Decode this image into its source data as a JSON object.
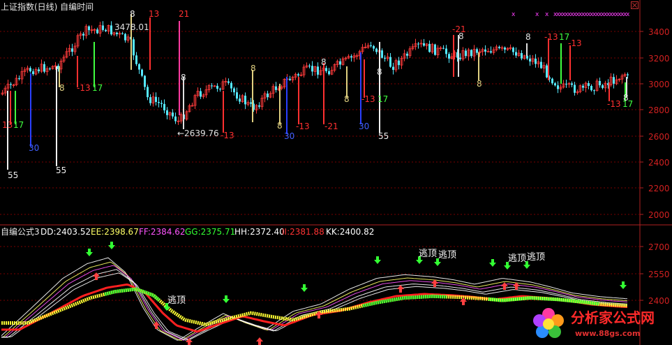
{
  "top_panel": {
    "title": "上证指数(日线) 自编时间",
    "y_ticks": [
      "3400",
      "3200",
      "3000",
      "2800",
      "2600",
      "2400",
      "2200",
      "2000"
    ],
    "annotations": {
      "high_label": "3478.01",
      "low_label": "←2639.76",
      "n8": "8",
      "n13": "13",
      "n17": "17",
      "n21": "21",
      "n30": "30",
      "n55": "55",
      "n_13": "-13",
      "n_21": "-21"
    }
  },
  "bottom_panel": {
    "indicator_name": "自编公式3",
    "values": {
      "dd": "DD:2403.52",
      "ee": "EE:2398.67",
      "ff": "FF:2384.62",
      "gg": "GG:2375.71",
      "hh": "HH:2372.40",
      "ii": "II:2381.88",
      "kk": "KK:2400.82"
    },
    "y_ticks": [
      "2700",
      "2550",
      "2400"
    ],
    "escape_label": "逃顶"
  },
  "watermark": {
    "text": "分析家公式网",
    "url": "www.88gs.com"
  },
  "colors": {
    "up": "#ff3b3b",
    "down": "#55e8ff",
    "grid": "#7a0000",
    "dd": "#ffffff",
    "ee": "#ffff66",
    "ff": "#ff55ff",
    "gg": "#33ff33",
    "hh": "#ffffff",
    "ii": "#ff3333",
    "kk": "#ffffff"
  }
}
